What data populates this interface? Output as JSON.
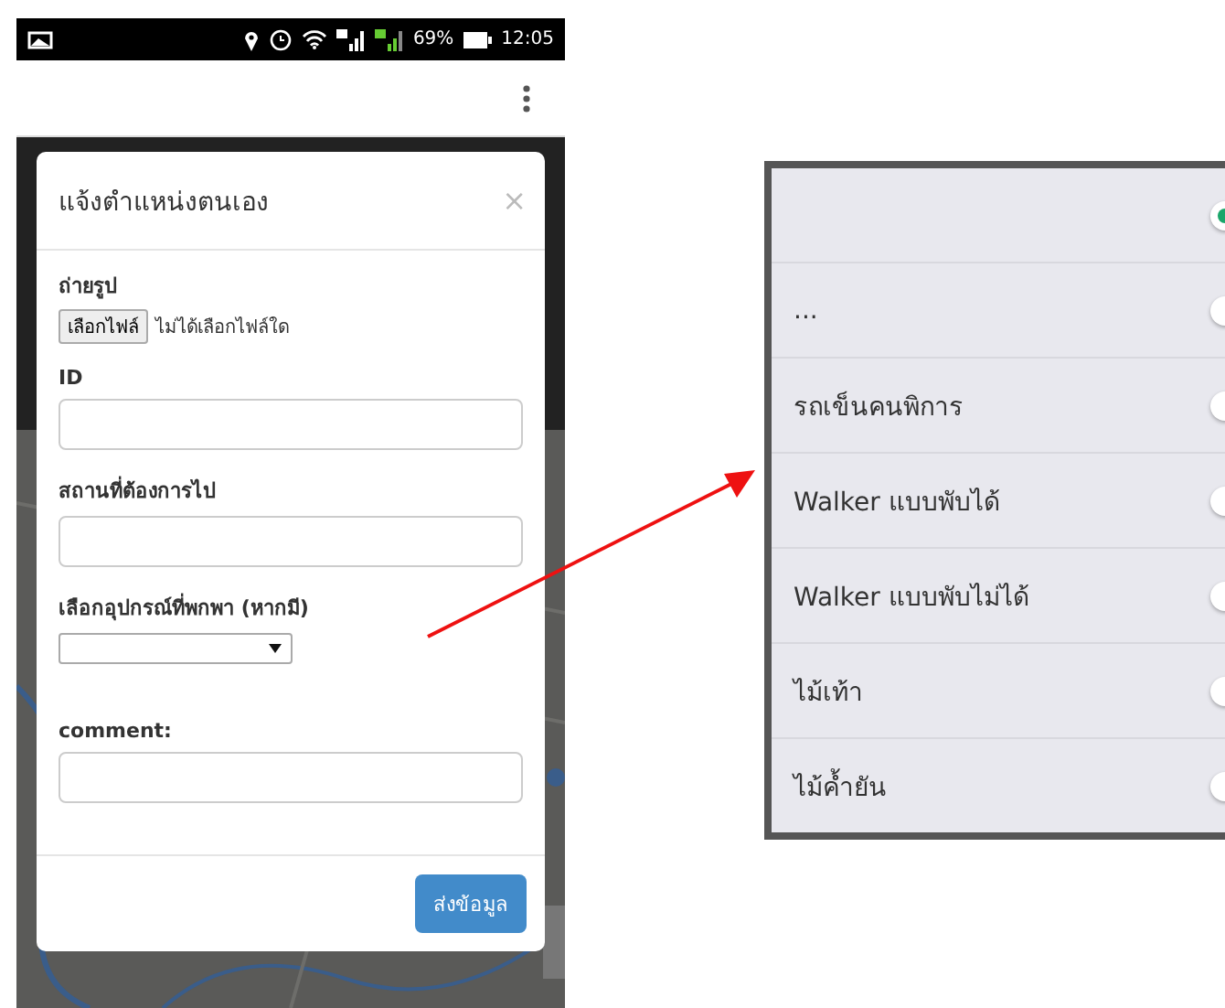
{
  "status_bar": {
    "battery": "69%",
    "time": "12:05"
  },
  "modal": {
    "title": "แจ้งตำแหน่งตนเอง",
    "close": "×",
    "photo_label": "ถ่ายรูป",
    "file_button": "เลือกไฟล์",
    "file_status": "ไม่ได้เลือกไฟล์ใด",
    "fields": [
      {
        "label": "ID",
        "kind": "text"
      },
      {
        "label": "สถานที่ต้องการไป",
        "kind": "text"
      },
      {
        "label": "เลือกอุปกรณ์ที่พกพา (หากมี)",
        "kind": "select"
      },
      {
        "label": "comment:",
        "kind": "text"
      }
    ],
    "submit": "ส่งข้อมูล"
  },
  "picker": {
    "options": [
      {
        "selected": true
      },
      {
        "label": "...",
        "selected": false
      },
      {
        "label": "รถเข็นคนพิการ",
        "selected": false
      },
      {
        "label": "Walker แบบพับได้",
        "selected": false
      },
      {
        "label": "Walker แบบพับไม่ได้",
        "selected": false
      },
      {
        "label": "ไม้เท้า",
        "selected": false
      },
      {
        "label": "ไม้ค้ำยัน",
        "selected": false
      }
    ]
  }
}
